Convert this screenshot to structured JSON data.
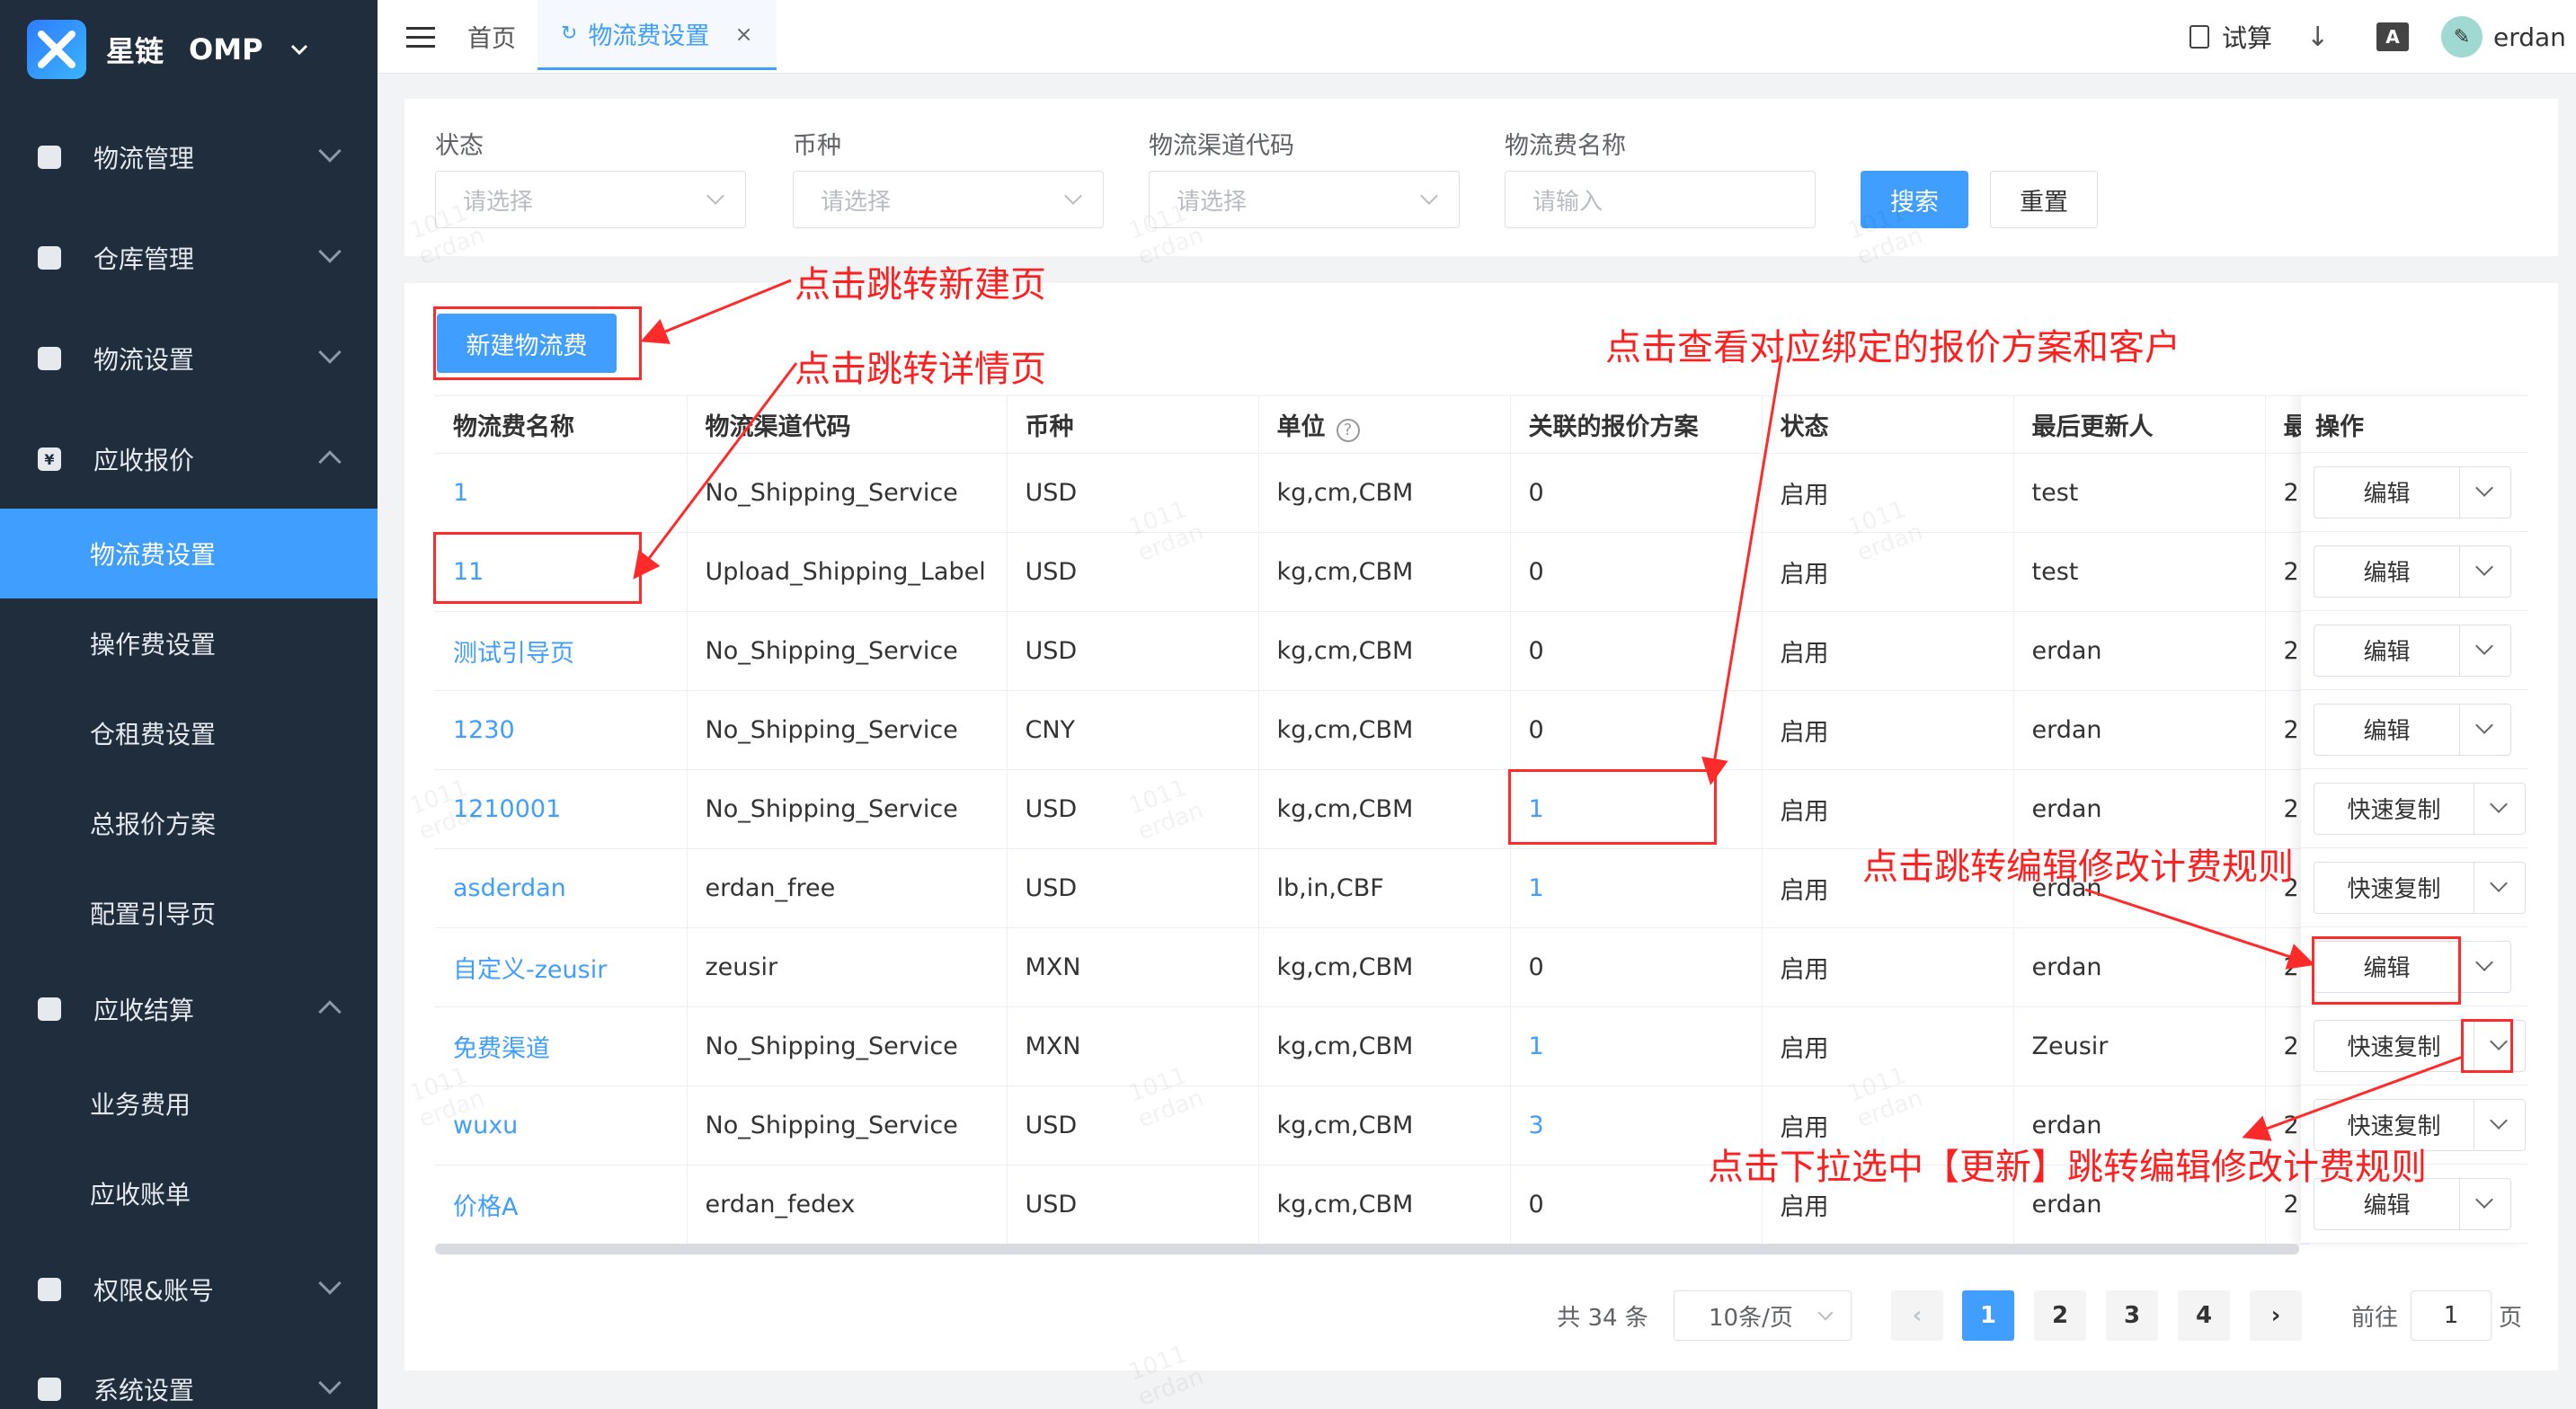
{
  "app": {
    "brand": "星链",
    "brand_sub": "OMP"
  },
  "sidebar": {
    "menus": [
      {
        "label": "物流管理",
        "icon": "truck-icon",
        "expanded": false
      },
      {
        "label": "仓库管理",
        "icon": "warehouse-icon",
        "expanded": false
      },
      {
        "label": "物流设置",
        "icon": "settings-box-icon",
        "expanded": false
      },
      {
        "label": "应收报价",
        "icon": "yen-icon",
        "expanded": true
      },
      {
        "label": "应收结算",
        "icon": "clipboard-icon",
        "expanded": true
      },
      {
        "label": "权限&账号",
        "icon": "shield-icon",
        "expanded": false
      },
      {
        "label": "系统设置",
        "icon": "gear-icon",
        "expanded": false
      }
    ],
    "quote_children": [
      "物流费设置",
      "操作费设置",
      "仓租费设置",
      "总报价方案",
      "配置引导页"
    ],
    "settle_children": [
      "业务费用",
      "应收账单"
    ],
    "active_item": "物流费设置"
  },
  "header": {
    "tabs": [
      {
        "label": "首页",
        "active": false
      },
      {
        "label": "物流费设置",
        "active": true
      }
    ],
    "tab_close": "×",
    "calc_label": "试算",
    "lang_icon": "A",
    "username": "erdan"
  },
  "filters": {
    "status": {
      "label": "状态",
      "placeholder": "请选择"
    },
    "currency": {
      "label": "币种",
      "placeholder": "请选择"
    },
    "channel": {
      "label": "物流渠道代码",
      "placeholder": "请选择"
    },
    "fee_name": {
      "label": "物流费名称",
      "placeholder": "请输入"
    },
    "search_btn": "搜索",
    "reset_btn": "重置"
  },
  "new_button": "新建物流费",
  "table": {
    "headers": [
      "物流费名称",
      "物流渠道代码",
      "币种",
      "单位",
      "关联的报价方案",
      "状态",
      "最后更新人",
      "最",
      "操作"
    ],
    "rows": [
      {
        "name": "1",
        "channel": "No_Shipping_Service",
        "currency": "USD",
        "unit": "kg,cm,CBM",
        "plans": "0",
        "status": "启用",
        "updater": "test",
        "last": "2",
        "action": "编辑"
      },
      {
        "name": "11",
        "channel": "Upload_Shipping_Label",
        "currency": "USD",
        "unit": "kg,cm,CBM",
        "plans": "0",
        "status": "启用",
        "updater": "test",
        "last": "2",
        "action": "编辑"
      },
      {
        "name": "测试引导页",
        "channel": "No_Shipping_Service",
        "currency": "USD",
        "unit": "kg,cm,CBM",
        "plans": "0",
        "status": "启用",
        "updater": "erdan",
        "last": "2",
        "action": "编辑"
      },
      {
        "name": "1230",
        "channel": "No_Shipping_Service",
        "currency": "CNY",
        "unit": "kg,cm,CBM",
        "plans": "0",
        "status": "启用",
        "updater": "erdan",
        "last": "2",
        "action": "编辑"
      },
      {
        "name": "1210001",
        "channel": "No_Shipping_Service",
        "currency": "USD",
        "unit": "kg,cm,CBM",
        "plans": "1",
        "status": "启用",
        "updater": "erdan",
        "last": "2",
        "action": "快速复制"
      },
      {
        "name": "asderdan",
        "channel": "erdan_free",
        "currency": "USD",
        "unit": "lb,in,CBF",
        "plans": "1",
        "status": "启用",
        "updater": "erdan",
        "last": "2",
        "action": "快速复制"
      },
      {
        "name": "自定义-zeusir",
        "channel": "zeusir",
        "currency": "MXN",
        "unit": "kg,cm,CBM",
        "plans": "0",
        "status": "启用",
        "updater": "erdan",
        "last": "2",
        "action": "编辑"
      },
      {
        "name": "免费渠道",
        "channel": "No_Shipping_Service",
        "currency": "MXN",
        "unit": "kg,cm,CBM",
        "plans": "1",
        "status": "启用",
        "updater": "Zeusir",
        "last": "2",
        "action": "快速复制"
      },
      {
        "name": "wuxu",
        "channel": "No_Shipping_Service",
        "currency": "USD",
        "unit": "kg,cm,CBM",
        "plans": "3",
        "status": "启用",
        "updater": "erdan",
        "last": "2",
        "action": "快速复制"
      },
      {
        "name": "价格A",
        "channel": "erdan_fedex",
        "currency": "USD",
        "unit": "kg,cm,CBM",
        "plans": "0",
        "status": "启用",
        "updater": "erdan",
        "last": "2",
        "action": "编辑"
      }
    ]
  },
  "pagination": {
    "total": "共 34 条",
    "page_size": "10条/页",
    "pages": [
      "1",
      "2",
      "3",
      "4"
    ],
    "current": "1",
    "goto_label": "前往",
    "goto_value": "1",
    "page_suffix": "页"
  },
  "annotations": {
    "new_page": "点击跳转新建页",
    "detail_page": "点击跳转详情页",
    "view_plans": "点击查看对应绑定的报价方案和客户",
    "edit_rules": "点击跳转编辑修改计费规则",
    "dropdown_update": "点击下拉选中【更新】跳转编辑修改计费规则"
  },
  "watermark": [
    "1011",
    "erdan"
  ],
  "colors": {
    "primary": "#409eff",
    "sidebar_bg": "#1f2d3d",
    "annotation": "#ff1f1f"
  }
}
